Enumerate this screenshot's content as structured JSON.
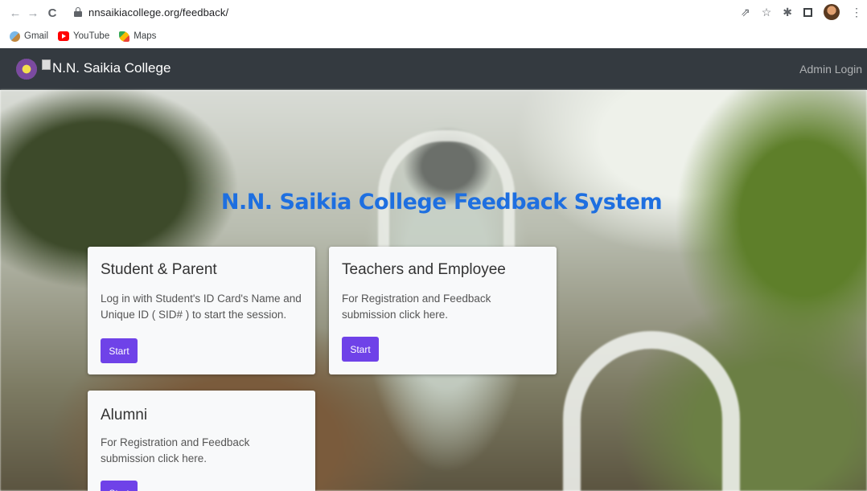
{
  "browser": {
    "url": "nnsaikiacollege.org/feedback/",
    "bookmarks": [
      {
        "label": "Gmail"
      },
      {
        "label": "YouTube"
      },
      {
        "label": "Maps"
      }
    ]
  },
  "navbar": {
    "brand": "N.N. Saikia College",
    "admin_login": "Admin Login"
  },
  "hero": {
    "title": "N.N. Saikia College Feedback System"
  },
  "cards": [
    {
      "title": "Student & Parent",
      "text": "Log in with Student's ID Card's Name and Unique ID ( SID# ) to start the session.",
      "button": "Start"
    },
    {
      "title": "Teachers and Employee",
      "text": "For Registration and Feedback submission click here.",
      "button": "Start"
    },
    {
      "title": "Alumni",
      "text": "For Registration and Feedback submission click here.",
      "button": "Start"
    }
  ],
  "colors": {
    "navbar_bg": "#343a40",
    "title_blue": "#1e6fe0",
    "button_purple": "#6f42e8"
  }
}
